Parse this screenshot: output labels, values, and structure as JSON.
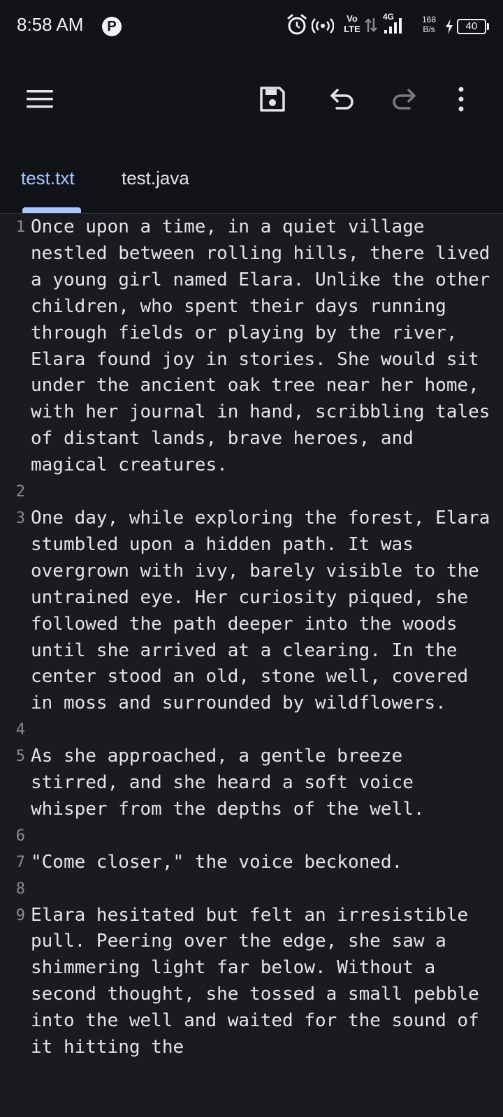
{
  "status_bar": {
    "time": "8:58 AM",
    "p_badge": "P",
    "volte_top": "Vo",
    "volte_bottom": "LTE",
    "network": "4G",
    "speed_value": "168",
    "speed_unit": "B/s",
    "battery_level": "40",
    "icons": [
      "alarm-icon",
      "hotspot-icon",
      "data-transfer-icon",
      "signal-icon",
      "charging-icon"
    ]
  },
  "toolbar": {
    "icons": [
      "menu-icon",
      "save-icon",
      "undo-icon",
      "redo-icon",
      "more-options-icon"
    ]
  },
  "tabs": [
    {
      "label": "test.txt",
      "active": true
    },
    {
      "label": "test.java",
      "active": false
    }
  ],
  "colors": {
    "accent": "#aac7ff",
    "background": "#1b1b1f",
    "bar_background": "#121318",
    "line_number": "#8a8a90",
    "text": "#e4e4e7"
  },
  "editor": {
    "lines": [
      {
        "number": "1",
        "text": "Once upon a time, in a quiet village nestled between rolling hills, there lived a young girl named Elara. Unlike the other children, who spent their days running through fields or playing by the river, Elara found joy in stories. She would sit under the ancient oak tree near her home, with her journal in hand, scribbling tales of distant lands, brave heroes, and magical creatures."
      },
      {
        "number": "2",
        "text": ""
      },
      {
        "number": "3",
        "text": "One day, while exploring the forest, Elara stumbled upon a hidden path. It was overgrown with ivy, barely visible to the untrained eye. Her curiosity piqued, she followed the path deeper into the woods until she arrived at a clearing. In the center stood an old, stone well, covered in moss and surrounded by wildflowers."
      },
      {
        "number": "4",
        "text": ""
      },
      {
        "number": "5",
        "text": "As she approached, a gentle breeze stirred, and she heard a soft voice whisper from the depths of the well."
      },
      {
        "number": "6",
        "text": ""
      },
      {
        "number": "7",
        "text": "\"Come closer,\" the voice beckoned."
      },
      {
        "number": "8",
        "text": ""
      },
      {
        "number": "9",
        "text": "Elara hesitated but felt an irresistible pull. Peering over the edge, she saw a shimmering light far below. Without a second thought, she tossed a small pebble into the well and waited for the sound of it hitting the"
      }
    ]
  }
}
